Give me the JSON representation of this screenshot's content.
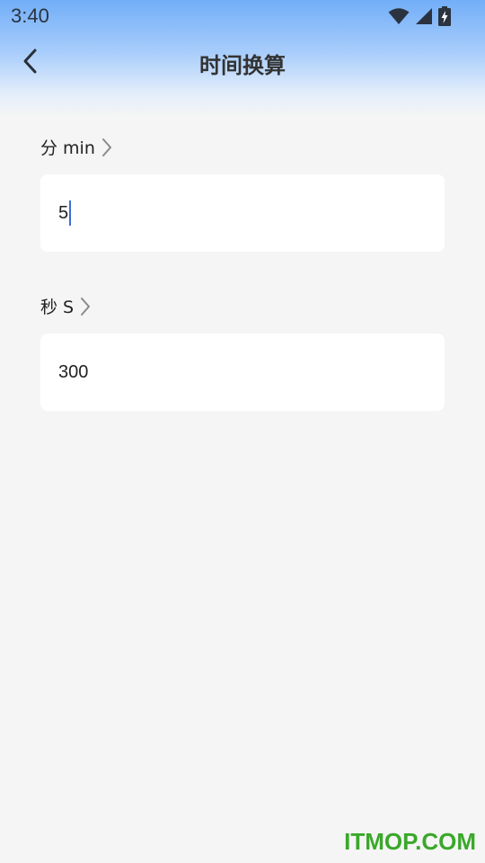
{
  "status_bar": {
    "time": "3:40",
    "icons": [
      "wifi-icon",
      "signal-icon",
      "battery-charging-icon"
    ]
  },
  "header": {
    "back_icon": "chevron-left-icon",
    "title": "时间换算"
  },
  "fields": [
    {
      "label": "分 min",
      "value": "5",
      "focused": true
    },
    {
      "label": "秒 S",
      "value": "300",
      "focused": false
    }
  ],
  "watermark": {
    "text": "ITMOP.COM"
  },
  "colors": {
    "gradient_top": "#72aef8",
    "background": "#f5f5f5",
    "card": "#ffffff",
    "caret": "#3a6fd8",
    "watermark": "#3aa82a"
  }
}
